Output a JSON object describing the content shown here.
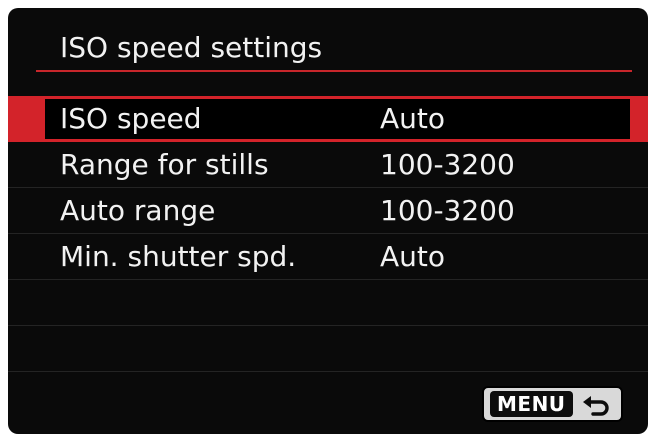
{
  "header": {
    "title": "ISO speed settings"
  },
  "items": [
    {
      "label": "ISO speed",
      "value": "Auto",
      "selected": true
    },
    {
      "label": "Range for stills",
      "value": "100-3200",
      "selected": false
    },
    {
      "label": "Auto range",
      "value": "100-3200",
      "selected": false
    },
    {
      "label": "Min. shutter spd.",
      "value": "Auto",
      "selected": false
    },
    {
      "label": "",
      "value": "",
      "selected": false
    },
    {
      "label": "",
      "value": "",
      "selected": false
    }
  ],
  "footer": {
    "menu_label": "MENU",
    "return_icon": "return-arrow-icon"
  },
  "colors": {
    "accent": "#d3232a",
    "background": "#0a0a0a",
    "text": "#f2f2f2"
  }
}
